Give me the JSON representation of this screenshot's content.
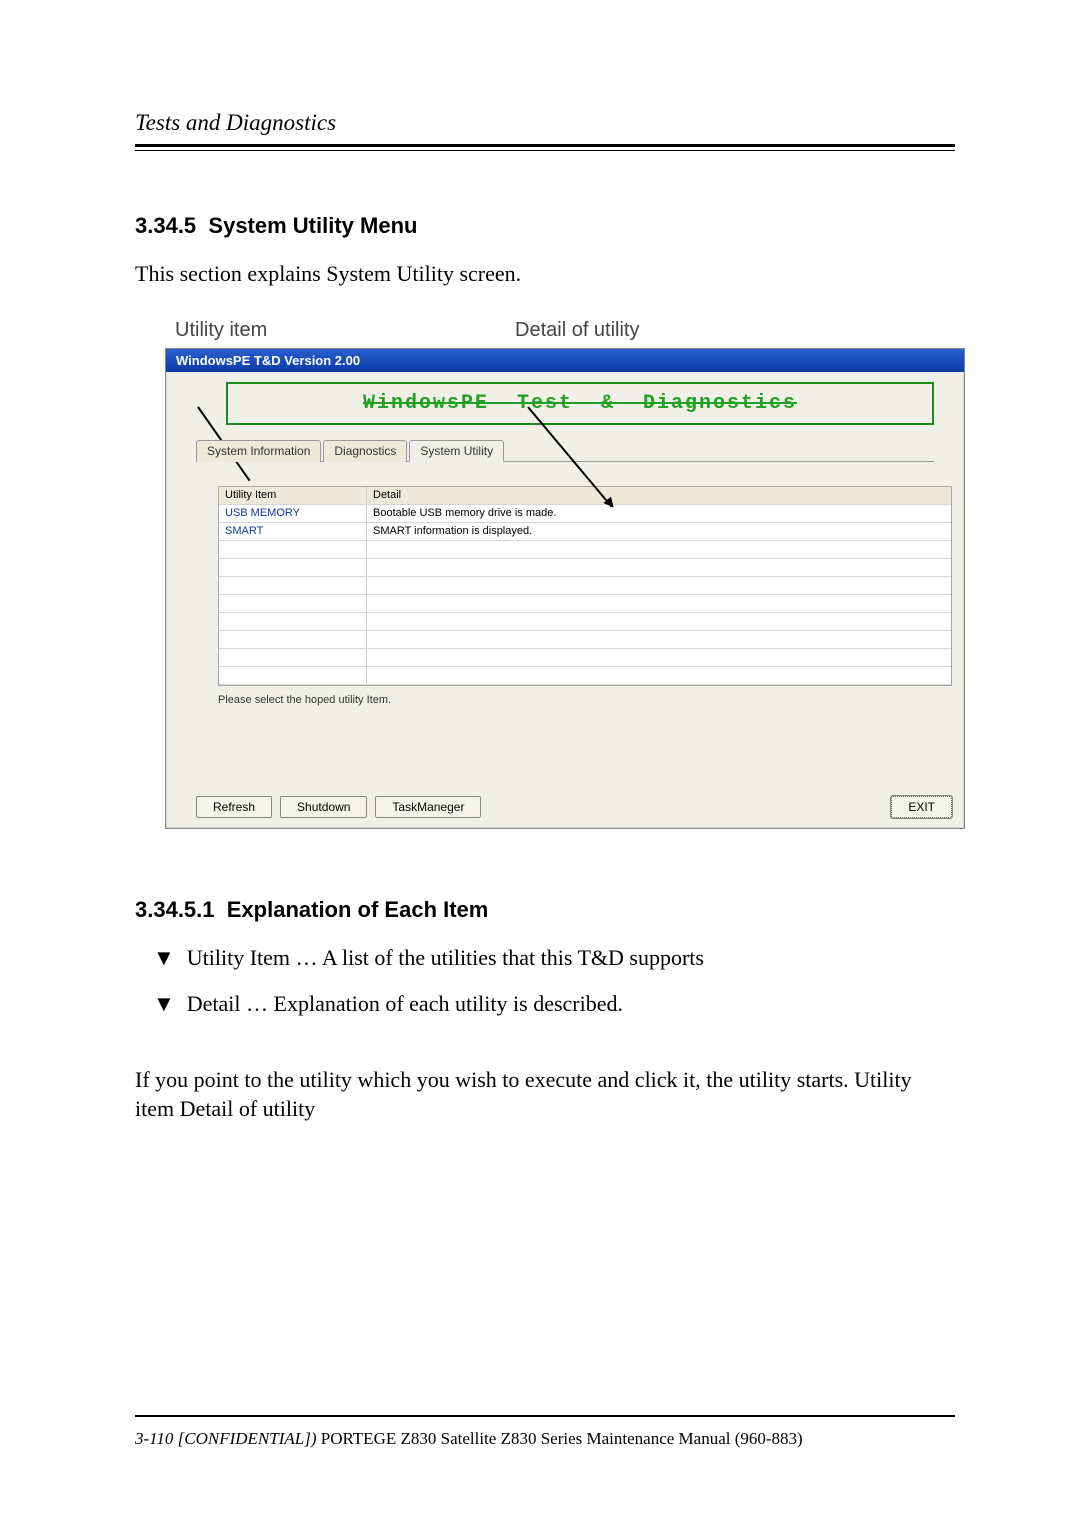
{
  "header": {
    "running_title": "Tests and Diagnostics"
  },
  "section": {
    "number": "3.34.5",
    "title": "System Utility Menu",
    "intro": "This section explains System Utility screen."
  },
  "figure": {
    "callout_left": "Utility item",
    "callout_right": "Detail of utility",
    "window_title": "WindowsPE T&D Version 2.00",
    "banner": "WindowsPE  Test  &  Diagnostics",
    "tabs": [
      {
        "label": "System Information",
        "active": false
      },
      {
        "label": "Diagnostics",
        "active": false
      },
      {
        "label": "System Utility",
        "active": true
      }
    ],
    "grid_headers": {
      "col_a": "Utility Item",
      "col_b": "Detail"
    },
    "grid_rows": [
      {
        "item": "USB MEMORY",
        "detail": "Bootable USB memory drive is made."
      },
      {
        "item": "SMART",
        "detail": "SMART information is displayed."
      }
    ],
    "select_message": "Please select the hoped utility Item.",
    "buttons": {
      "refresh": "Refresh",
      "shutdown": "Shutdown",
      "taskmgr": "TaskManeger",
      "exit": "EXIT"
    }
  },
  "subsection": {
    "number": "3.34.5.1",
    "title": "Explanation of Each Item",
    "bullets": [
      "Utility Item … A list of the utilities that this T&D supports",
      "Detail … Explanation of each utility is described."
    ],
    "note": "If you point to the utility which you wish to execute and click it, the utility starts. Utility item Detail of utility"
  },
  "footer": {
    "page_ref": "3-110 [CONFIDENTIAL])",
    "manual": " PORTEGE Z830 Satellite Z830 Series Maintenance Manual (960-883)"
  }
}
